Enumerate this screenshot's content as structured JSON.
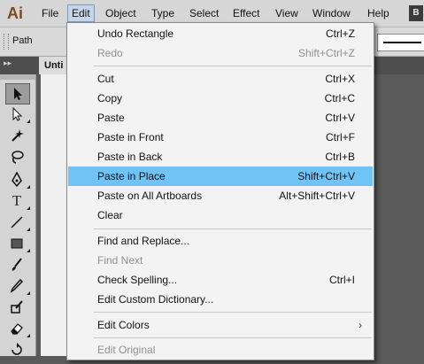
{
  "app": {
    "logo": "Ai",
    "bridge_label": "B"
  },
  "menubar": {
    "items": [
      "File",
      "Edit",
      "Object",
      "Type",
      "Select",
      "Effect",
      "View",
      "Window",
      "Help"
    ]
  },
  "controlbar": {
    "object_label": "Path"
  },
  "document": {
    "tab_label": "Unti"
  },
  "edit_menu": {
    "items": [
      {
        "label": "Undo Rectangle",
        "shortcut": "Ctrl+Z",
        "enabled": true
      },
      {
        "label": "Redo",
        "shortcut": "Shift+Ctrl+Z",
        "enabled": false
      },
      {
        "label": "Cut",
        "shortcut": "Ctrl+X",
        "enabled": true
      },
      {
        "label": "Copy",
        "shortcut": "Ctrl+C",
        "enabled": true
      },
      {
        "label": "Paste",
        "shortcut": "Ctrl+V",
        "enabled": true
      },
      {
        "label": "Paste in Front",
        "shortcut": "Ctrl+F",
        "enabled": true
      },
      {
        "label": "Paste in Back",
        "shortcut": "Ctrl+B",
        "enabled": true
      },
      {
        "label": "Paste in Place",
        "shortcut": "Shift+Ctrl+V",
        "enabled": true,
        "highlighted": true
      },
      {
        "label": "Paste on All Artboards",
        "shortcut": "Alt+Shift+Ctrl+V",
        "enabled": true
      },
      {
        "label": "Clear",
        "shortcut": "",
        "enabled": true
      },
      {
        "label": "Find and Replace...",
        "shortcut": "",
        "enabled": true
      },
      {
        "label": "Find Next",
        "shortcut": "",
        "enabled": false
      },
      {
        "label": "Check Spelling...",
        "shortcut": "Ctrl+I",
        "enabled": true
      },
      {
        "label": "Edit Custom Dictionary...",
        "shortcut": "",
        "enabled": true
      },
      {
        "label": "Edit Colors",
        "shortcut": "",
        "enabled": true,
        "submenu": true
      },
      {
        "label": "Edit Original",
        "shortcut": "",
        "enabled": false
      }
    ]
  },
  "colors": {
    "highlight": "#70c3f5",
    "menu_bg": "#f3f3f3",
    "disabled_text": "#8f8f8f"
  },
  "tools": [
    "selection-tool",
    "direct-selection-tool",
    "magic-wand-tool",
    "lasso-tool",
    "pen-tool",
    "type-tool",
    "line-segment-tool",
    "rectangle-tool",
    "paintbrush-tool",
    "pencil-tool",
    "blob-brush-tool",
    "eraser-tool",
    "rotate-tool"
  ]
}
